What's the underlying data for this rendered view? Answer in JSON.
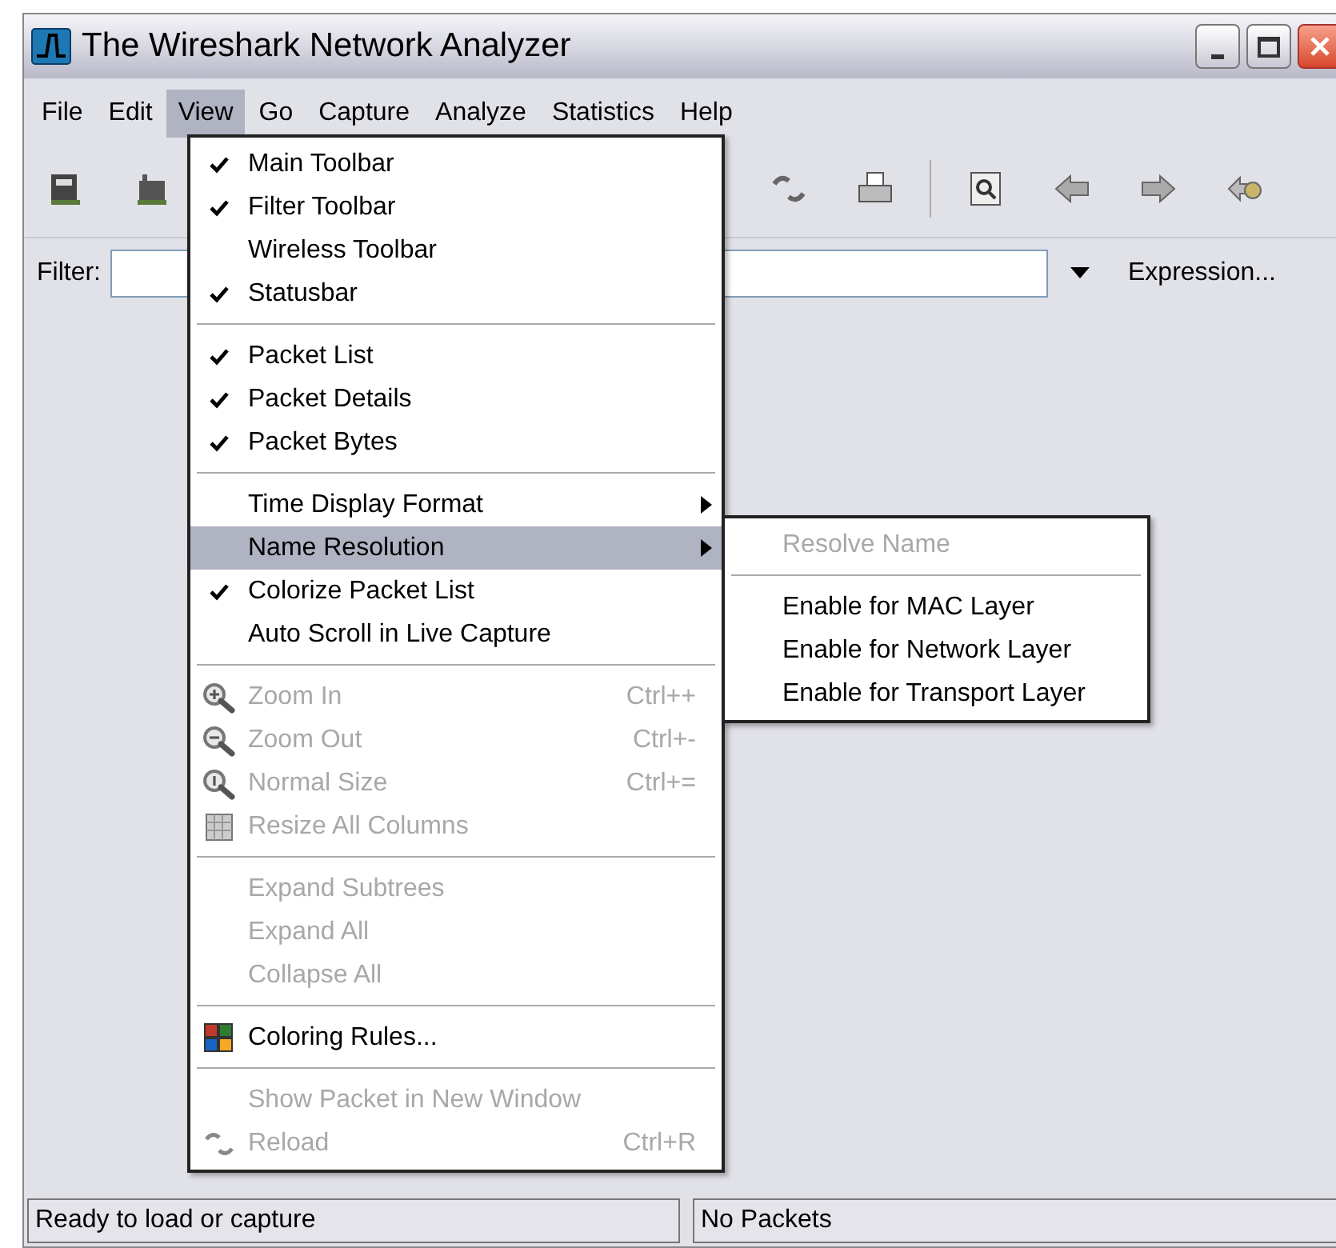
{
  "window": {
    "title": "The Wireshark Network Analyzer"
  },
  "menu_bar": [
    {
      "label": "File",
      "selected": false
    },
    {
      "label": "Edit",
      "selected": false
    },
    {
      "label": "View",
      "selected": true
    },
    {
      "label": "Go",
      "selected": false
    },
    {
      "label": "Capture",
      "selected": false
    },
    {
      "label": "Analyze",
      "selected": false
    },
    {
      "label": "Statistics",
      "selected": false
    },
    {
      "label": "Help",
      "selected": false
    }
  ],
  "filter_bar": {
    "label": "Filter:",
    "expression_button": "Expression..."
  },
  "view_menu": [
    {
      "kind": "toggle",
      "label": "Main Toolbar",
      "checked": true
    },
    {
      "kind": "toggle",
      "label": "Filter Toolbar",
      "checked": true
    },
    {
      "kind": "toggle",
      "label": "Wireless Toolbar",
      "checked": false
    },
    {
      "kind": "toggle",
      "label": "Statusbar",
      "checked": true
    },
    {
      "kind": "separator"
    },
    {
      "kind": "toggle",
      "label": "Packet List",
      "checked": true
    },
    {
      "kind": "toggle",
      "label": "Packet Details",
      "checked": true
    },
    {
      "kind": "toggle",
      "label": "Packet Bytes",
      "checked": true
    },
    {
      "kind": "separator"
    },
    {
      "kind": "submenu",
      "label": "Time Display Format",
      "selected": false
    },
    {
      "kind": "submenu",
      "label": "Name Resolution",
      "selected": true
    },
    {
      "kind": "toggle",
      "label": "Colorize Packet List",
      "checked": true
    },
    {
      "kind": "toggle",
      "label": "Auto Scroll in Live Capture",
      "checked": false
    },
    {
      "kind": "separator"
    },
    {
      "kind": "zoom_in",
      "label": "Zoom In",
      "shortcut": "Ctrl++",
      "disabled": true
    },
    {
      "kind": "zoom_out",
      "label": "Zoom Out",
      "shortcut": "Ctrl+-",
      "disabled": true
    },
    {
      "kind": "zoom_normal",
      "label": "Normal Size",
      "shortcut": "Ctrl+=",
      "disabled": true
    },
    {
      "kind": "resize",
      "label": "Resize All Columns",
      "disabled": true
    },
    {
      "kind": "separator"
    },
    {
      "kind": "plain",
      "label": "Expand Subtrees",
      "disabled": true
    },
    {
      "kind": "plain",
      "label": "Expand All",
      "disabled": true
    },
    {
      "kind": "plain",
      "label": "Collapse All",
      "disabled": true
    },
    {
      "kind": "separator"
    },
    {
      "kind": "coloring",
      "label": "Coloring Rules...",
      "disabled": false
    },
    {
      "kind": "separator"
    },
    {
      "kind": "plain",
      "label": "Show Packet in New Window",
      "disabled": true
    },
    {
      "kind": "reload",
      "label": "Reload",
      "shortcut": "Ctrl+R",
      "disabled": true
    }
  ],
  "name_resolution_submenu": [
    {
      "kind": "plain",
      "label": "Resolve Name",
      "disabled": true
    },
    {
      "kind": "separator"
    },
    {
      "kind": "plain",
      "label": "Enable for MAC Layer",
      "disabled": false
    },
    {
      "kind": "plain",
      "label": "Enable for Network Layer",
      "disabled": false
    },
    {
      "kind": "plain",
      "label": "Enable for Transport Layer",
      "disabled": false
    }
  ],
  "status_bar": {
    "left": "Ready to load or capture",
    "right": "No Packets"
  }
}
